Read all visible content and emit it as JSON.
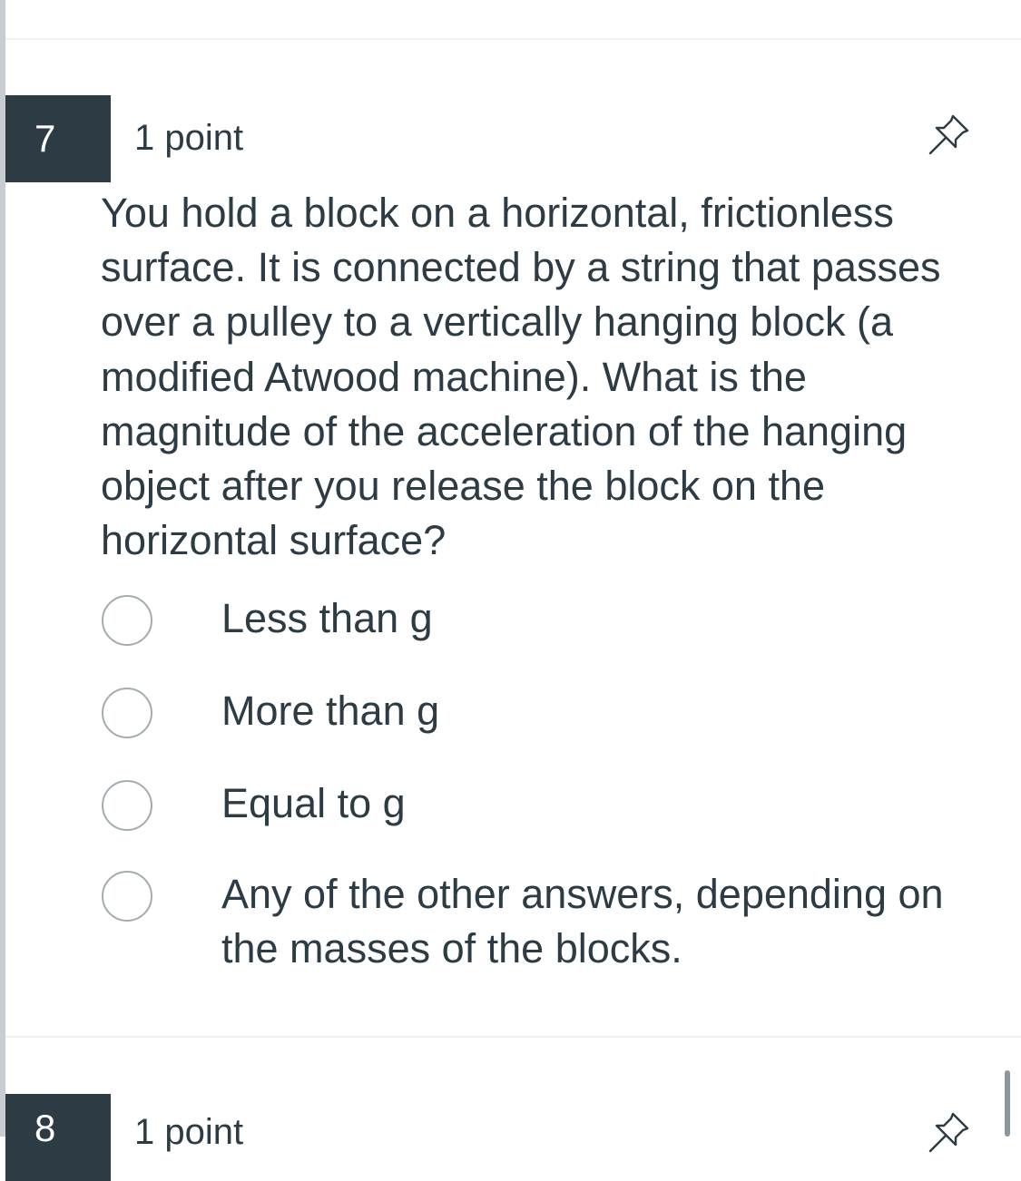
{
  "question7": {
    "number": "7",
    "points": "1 point",
    "text": "You hold a block on a horizontal, frictionless surface. It is connected by a string that passes over a pulley to a vertically hanging block (a modified Atwood machine). What is the magnitude of the acceleration of the hanging object after you release the block on the horizontal surface?",
    "answers": [
      {
        "label": "Less than g"
      },
      {
        "label": "More than g"
      },
      {
        "label": "Equal to g"
      },
      {
        "label": "Any of the other answers, depending on the masses of the blocks."
      }
    ]
  },
  "question8": {
    "number": "8",
    "points": "1 point"
  },
  "icons": {
    "pin": "pin-icon"
  },
  "colors": {
    "number_badge_bg": "#2d3b45",
    "text": "#2d3b45",
    "radio_border": "#a3acb1"
  }
}
